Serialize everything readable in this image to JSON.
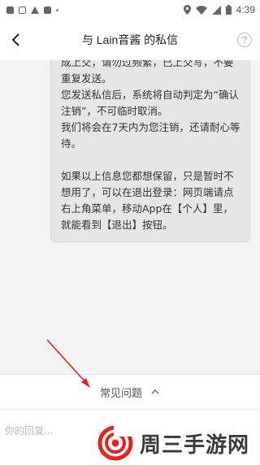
{
  "status_bar": {
    "time": "4:39",
    "icons": [
      "notification-square-icon",
      "outline-square-icon",
      "warning-icon",
      "notification-square-icon",
      "dots-icon",
      "location-icon",
      "wifi-icon",
      "signal-icon",
      "battery-icon"
    ]
  },
  "header": {
    "title": "与 Lain音酱 的私信",
    "back_icon": "back-arrow-icon",
    "help_icon": "help-icon",
    "help_glyph": "?"
  },
  "chat": {
    "message_paragraphs": [
      "成上交，请勿过频繁，已上交写，不要重复发送。",
      "您发送私信后，系统将自动判定为“确认注销”，不可临时取消。",
      "我们将会在7天内为您注销，还请耐心等待。",
      "",
      "如果以上信息您都想保留，只是暂时不想用了，可以在退出登录：网页端请点右上角菜单，移动App在【个人】里，就能看到【退出】按钮。"
    ]
  },
  "faq": {
    "label": "常见问题",
    "chevron_icon": "chevron-up-icon"
  },
  "reply": {
    "placeholder": "你的回复..."
  },
  "watermark": {
    "text": "周三手游网"
  },
  "colors": {
    "bubble_bg": "#e6e6e6",
    "arrow": "#e8231b",
    "logo_red": "#e8231b"
  }
}
